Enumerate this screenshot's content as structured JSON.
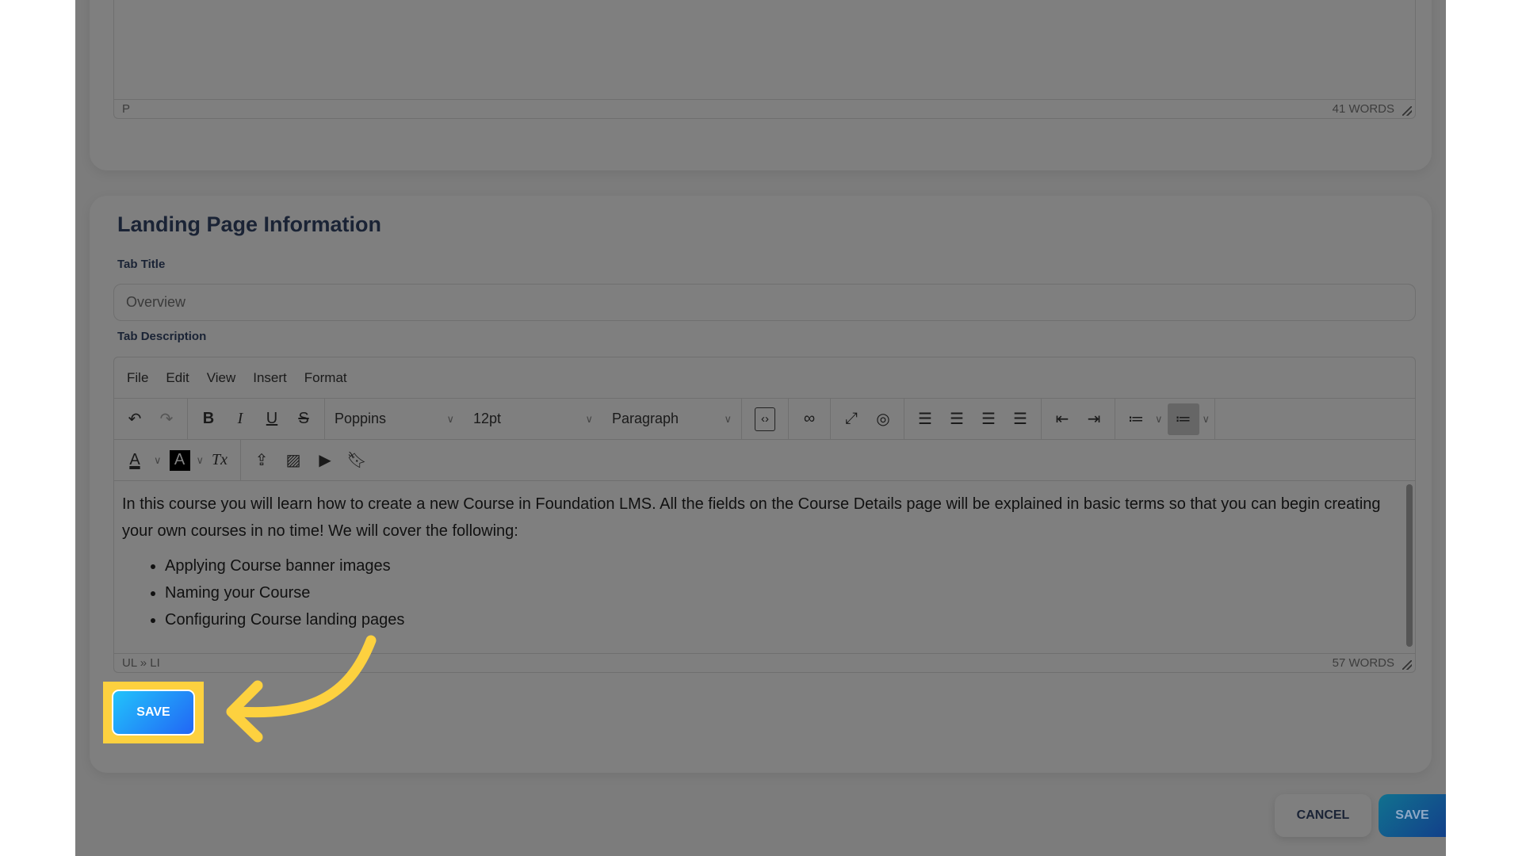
{
  "top_editor": {
    "path": "P",
    "word_count": "41 WORDS"
  },
  "section": {
    "title": "Landing Page Information",
    "tab_title_label": "Tab Title",
    "tab_title_value": "Overview",
    "tab_description_label": "Tab Description"
  },
  "editor": {
    "menu": [
      "File",
      "Edit",
      "View",
      "Insert",
      "Format"
    ],
    "font_family": "Poppins",
    "font_size": "12pt",
    "block_format": "Paragraph",
    "icons": {
      "undo": "↶",
      "redo": "↷",
      "bold": "B",
      "italic": "I",
      "underline": "U",
      "strike": "S",
      "code": "‹›",
      "link": "∞",
      "fullscreen": "⤢",
      "preview": "◎",
      "text_color": "A",
      "highlight": "A",
      "clear_format": "Tx"
    },
    "paragraph": "In this course you will learn how to create a new Course in Foundation LMS. All the fields on the Course Details page will be explained in basic terms so that you can begin creating your own courses in no time! We will cover the following:",
    "bullets": [
      "Applying Course banner images",
      "Naming your Course",
      "Configuring Course landing pages"
    ],
    "path": "UL » LI",
    "word_count": "57 WORDS"
  },
  "save_label": "SAVE",
  "footer": {
    "cancel_label": "CANCEL",
    "save_label": "SAVE"
  },
  "colors": {
    "highlight": "#fdd13f",
    "save_gradient_start": "#22c3fb",
    "save_gradient_end": "#2266f5"
  }
}
